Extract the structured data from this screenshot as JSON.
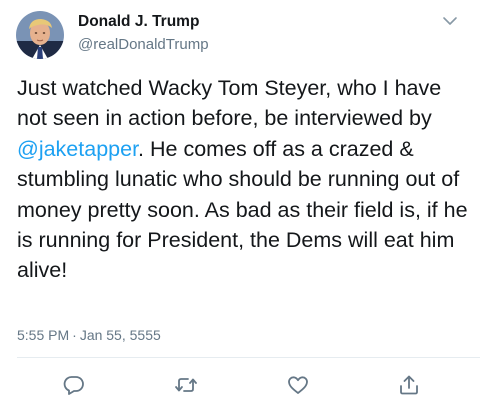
{
  "author": {
    "display_name": "Donald J. Trump",
    "handle": "@realDonaldTrump",
    "avatar": "profile-photo"
  },
  "tweet": {
    "text_before": "Just watched Wacky Tom Steyer, who I have not seen in action before, be interviewed by ",
    "mention": "@jaketapper",
    "text_after": ". He comes off as a crazed & stumbling lunatic who should be running out of money pretty soon. As bad as their field is, if he is running for President, the Dems will eat him alive!",
    "time": "5:55 PM",
    "separator": "·",
    "date": "Jan 55, 5555"
  },
  "actions": [
    {
      "name": "reply",
      "icon": "speech-bubble"
    },
    {
      "name": "retweet",
      "icon": "retweet-arrows"
    },
    {
      "name": "like",
      "icon": "heart"
    },
    {
      "name": "share",
      "icon": "share-up-arrow"
    }
  ],
  "colors": {
    "text": "#14171a",
    "secondary": "#657786",
    "link": "#1da1f2",
    "divider": "#e6ecf0"
  }
}
